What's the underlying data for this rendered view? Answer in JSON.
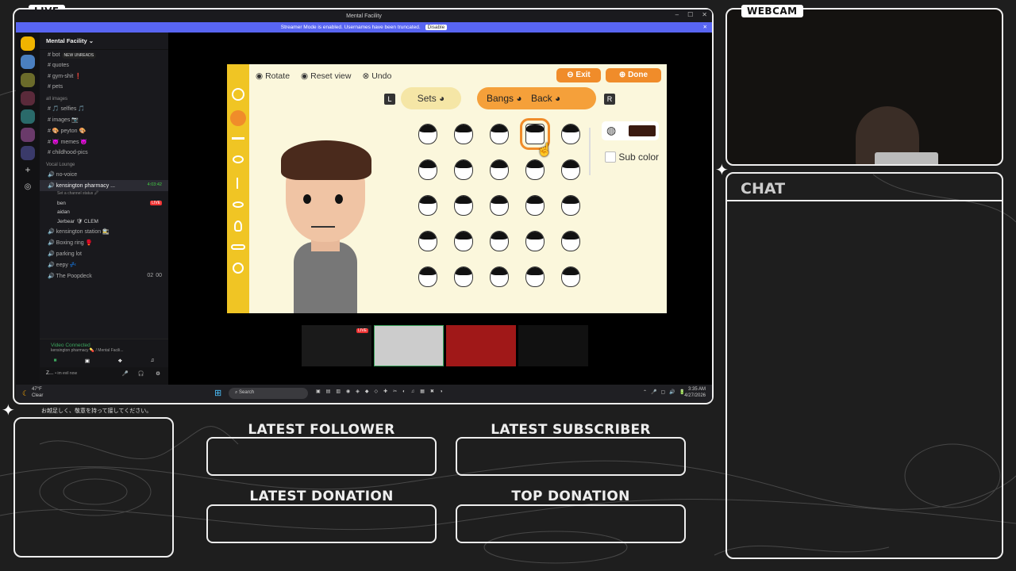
{
  "overlay": {
    "live_tag": "LIVE",
    "webcam_tag": "WEBCAM",
    "chat_title": "CHAT",
    "marquee": "お越足しく、敬意を持って接してください。",
    "latest_follower": "LATEST FOLLOWER",
    "latest_subscriber": "LATEST SUBSCRIBER",
    "latest_donation": "LATEST DONATION",
    "top_donation": "TOP DONATION"
  },
  "discord": {
    "window_title": "Mental Facility",
    "stream_banner": "Streamer Mode is enabled. Usernames have been truncated.",
    "disable_label": "Disable",
    "server_name": "Mental Facility",
    "new_unreads": "NEW UNREADS",
    "channels_top": [
      "bot",
      "quotes",
      "gym-shit ❗",
      "pets"
    ],
    "category_images": "all images",
    "channels_images": [
      "🎵 selfies 🎵",
      "images 📷",
      "🎨 peyton 🎨",
      "😈 memes 😈",
      "childhood-pics"
    ],
    "category_voice": "Vocal Lounge",
    "voice_channels": {
      "no_voice": "no-voice",
      "kensington": "kensington pharmacy ...",
      "timer": "4:03:42",
      "set_status": "Set a channel status 🖉",
      "members": [
        "ben",
        "aidan",
        "Jerbear 🛡 CLEM"
      ],
      "live": "LIVE",
      "others": [
        "kensington station 🚉",
        "Boxing ring 🥊",
        "parking lot",
        "eepy 💤",
        "The Poopdeck"
      ],
      "poop_counts": [
        "00",
        "02"
      ]
    },
    "vc_status": "Video Connected",
    "vc_sub": "kensington pharmacy 💊 / Mental Facili...",
    "user_name": "Z...",
    "user_status": "• im evil now",
    "weather_temp": "47°F",
    "weather_desc": "Clear",
    "search": "Search",
    "time": "3:35 AM",
    "date": "4/27/2026"
  },
  "game": {
    "rotate": "Rotate",
    "reset": "Reset view",
    "undo": "Undo",
    "exit": "Exit",
    "done": "Done",
    "sets": "Sets",
    "bangs": "Bangs",
    "back": "Back",
    "sub_color": "Sub color",
    "l": "L",
    "r": "R",
    "hair_color": "#3a1a10"
  }
}
